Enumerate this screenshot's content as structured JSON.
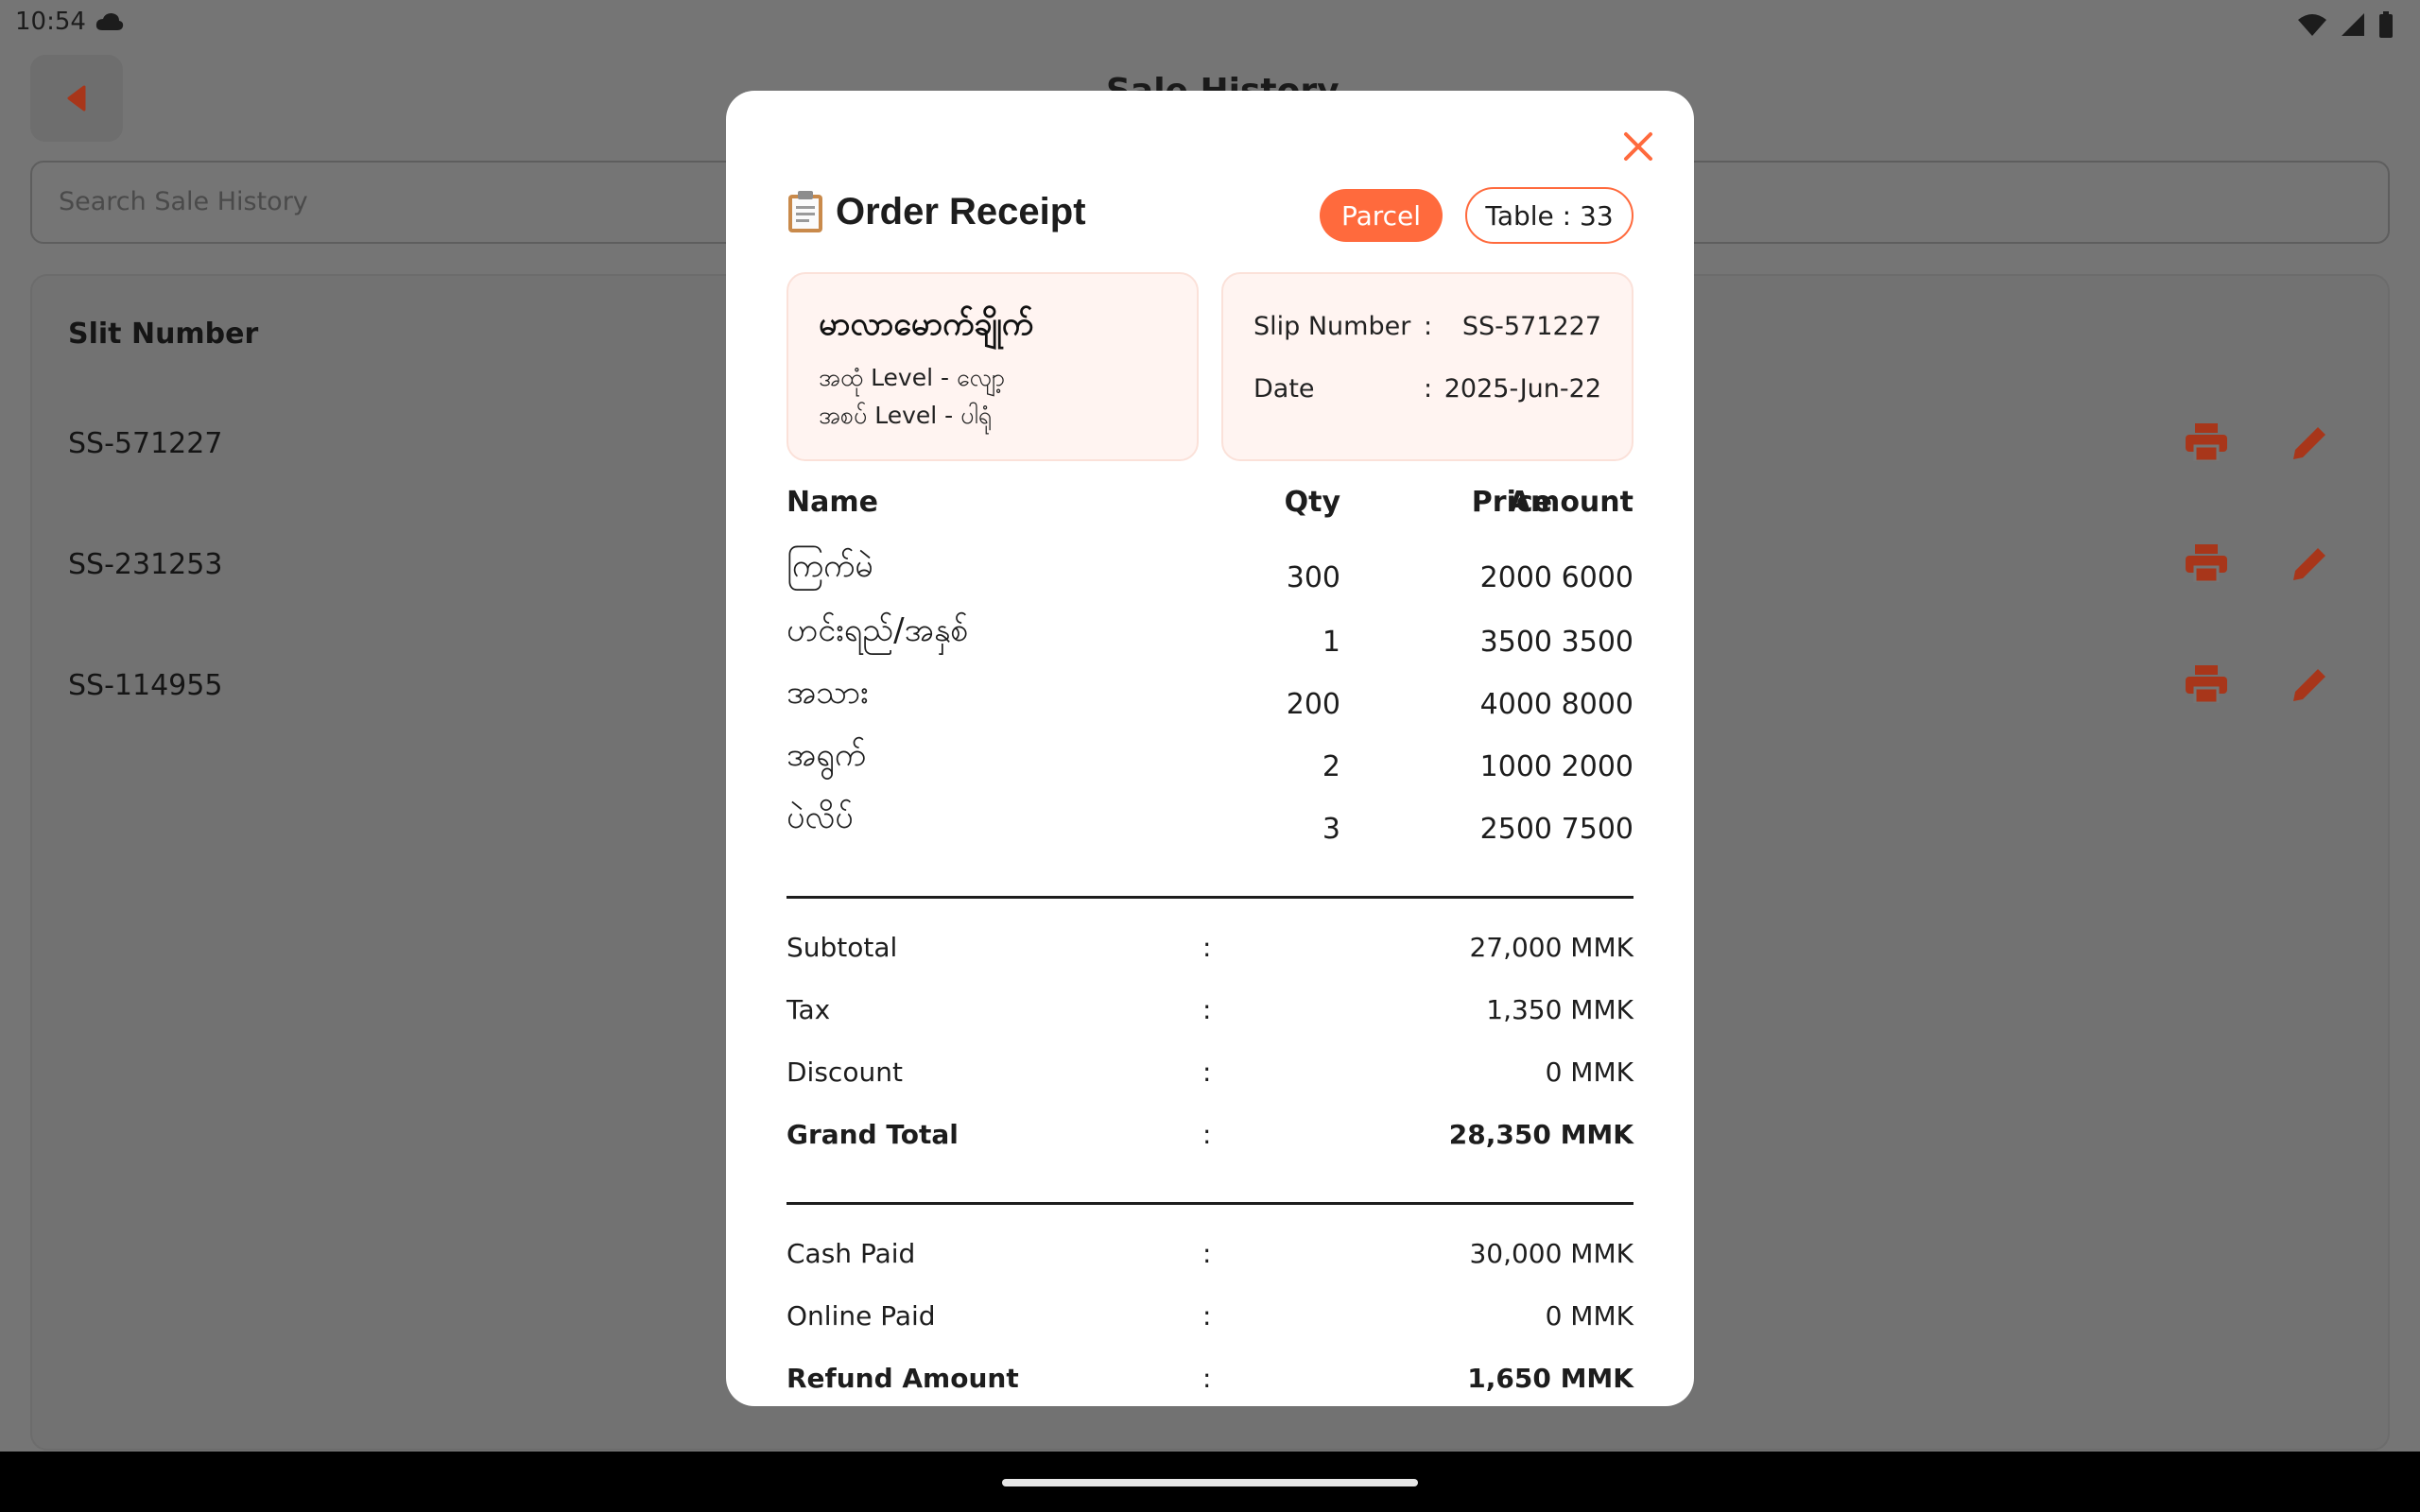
{
  "status_bar": {
    "time": "10:54"
  },
  "background": {
    "title": "Sale History",
    "search_placeholder": "Search Sale History",
    "list_header": "Slit Number",
    "rows": [
      "SS-571227",
      "SS-231253",
      "SS-114955"
    ]
  },
  "receipt": {
    "title": "Order Receipt",
    "order_type": "Parcel",
    "table_label": "Table : 33",
    "shop": {
      "name": "မာလာမောက်ချိုက်",
      "line1": "အထုံ Level - လျော့",
      "line2": "အစပ် Level - ပါရုံ"
    },
    "slip_label": "Slip Number",
    "slip_value": "SS-571227",
    "date_label": "Date",
    "date_value": "2025-Jun-22",
    "colon": ":",
    "columns": {
      "name": "Name",
      "qty": "Qty",
      "price": "Price",
      "amount": "Amount"
    },
    "items": [
      {
        "name": "ကြက်မဲ",
        "qty": "300",
        "price": "2000",
        "amount": "6000"
      },
      {
        "name": "ဟင်းရည်/အနှစ်",
        "qty": "1",
        "price": "3500",
        "amount": "3500"
      },
      {
        "name": "အသား",
        "qty": "200",
        "price": "4000",
        "amount": "8000"
      },
      {
        "name": "အရွက်",
        "qty": "2",
        "price": "1000",
        "amount": "2000"
      },
      {
        "name": "ပဲလိပ်",
        "qty": "3",
        "price": "2500",
        "amount": "7500"
      }
    ],
    "summary": {
      "subtotal_label": "Subtotal",
      "subtotal": "27,000 MMK",
      "tax_label": "Tax",
      "tax": "1,350 MMK",
      "discount_label": "Discount",
      "discount": "0 MMK",
      "grand_label": "Grand Total",
      "grand": "28,350 MMK"
    },
    "payment": {
      "cash_label": "Cash Paid",
      "cash": "30,000 MMK",
      "online_label": "Online Paid",
      "online": "0 MMK",
      "refund_label": "Refund Amount",
      "refund": "1,650 MMK"
    }
  },
  "colors": {
    "accent": "#ff6a3d",
    "dark_accent": "#a8361a",
    "scrim": "#757575"
  },
  "icons": [
    "cloud-icon",
    "wifi-icon",
    "signal-icon",
    "battery-icon",
    "back-arrow-icon",
    "print-icon",
    "edit-icon",
    "close-icon",
    "clipboard-icon"
  ]
}
